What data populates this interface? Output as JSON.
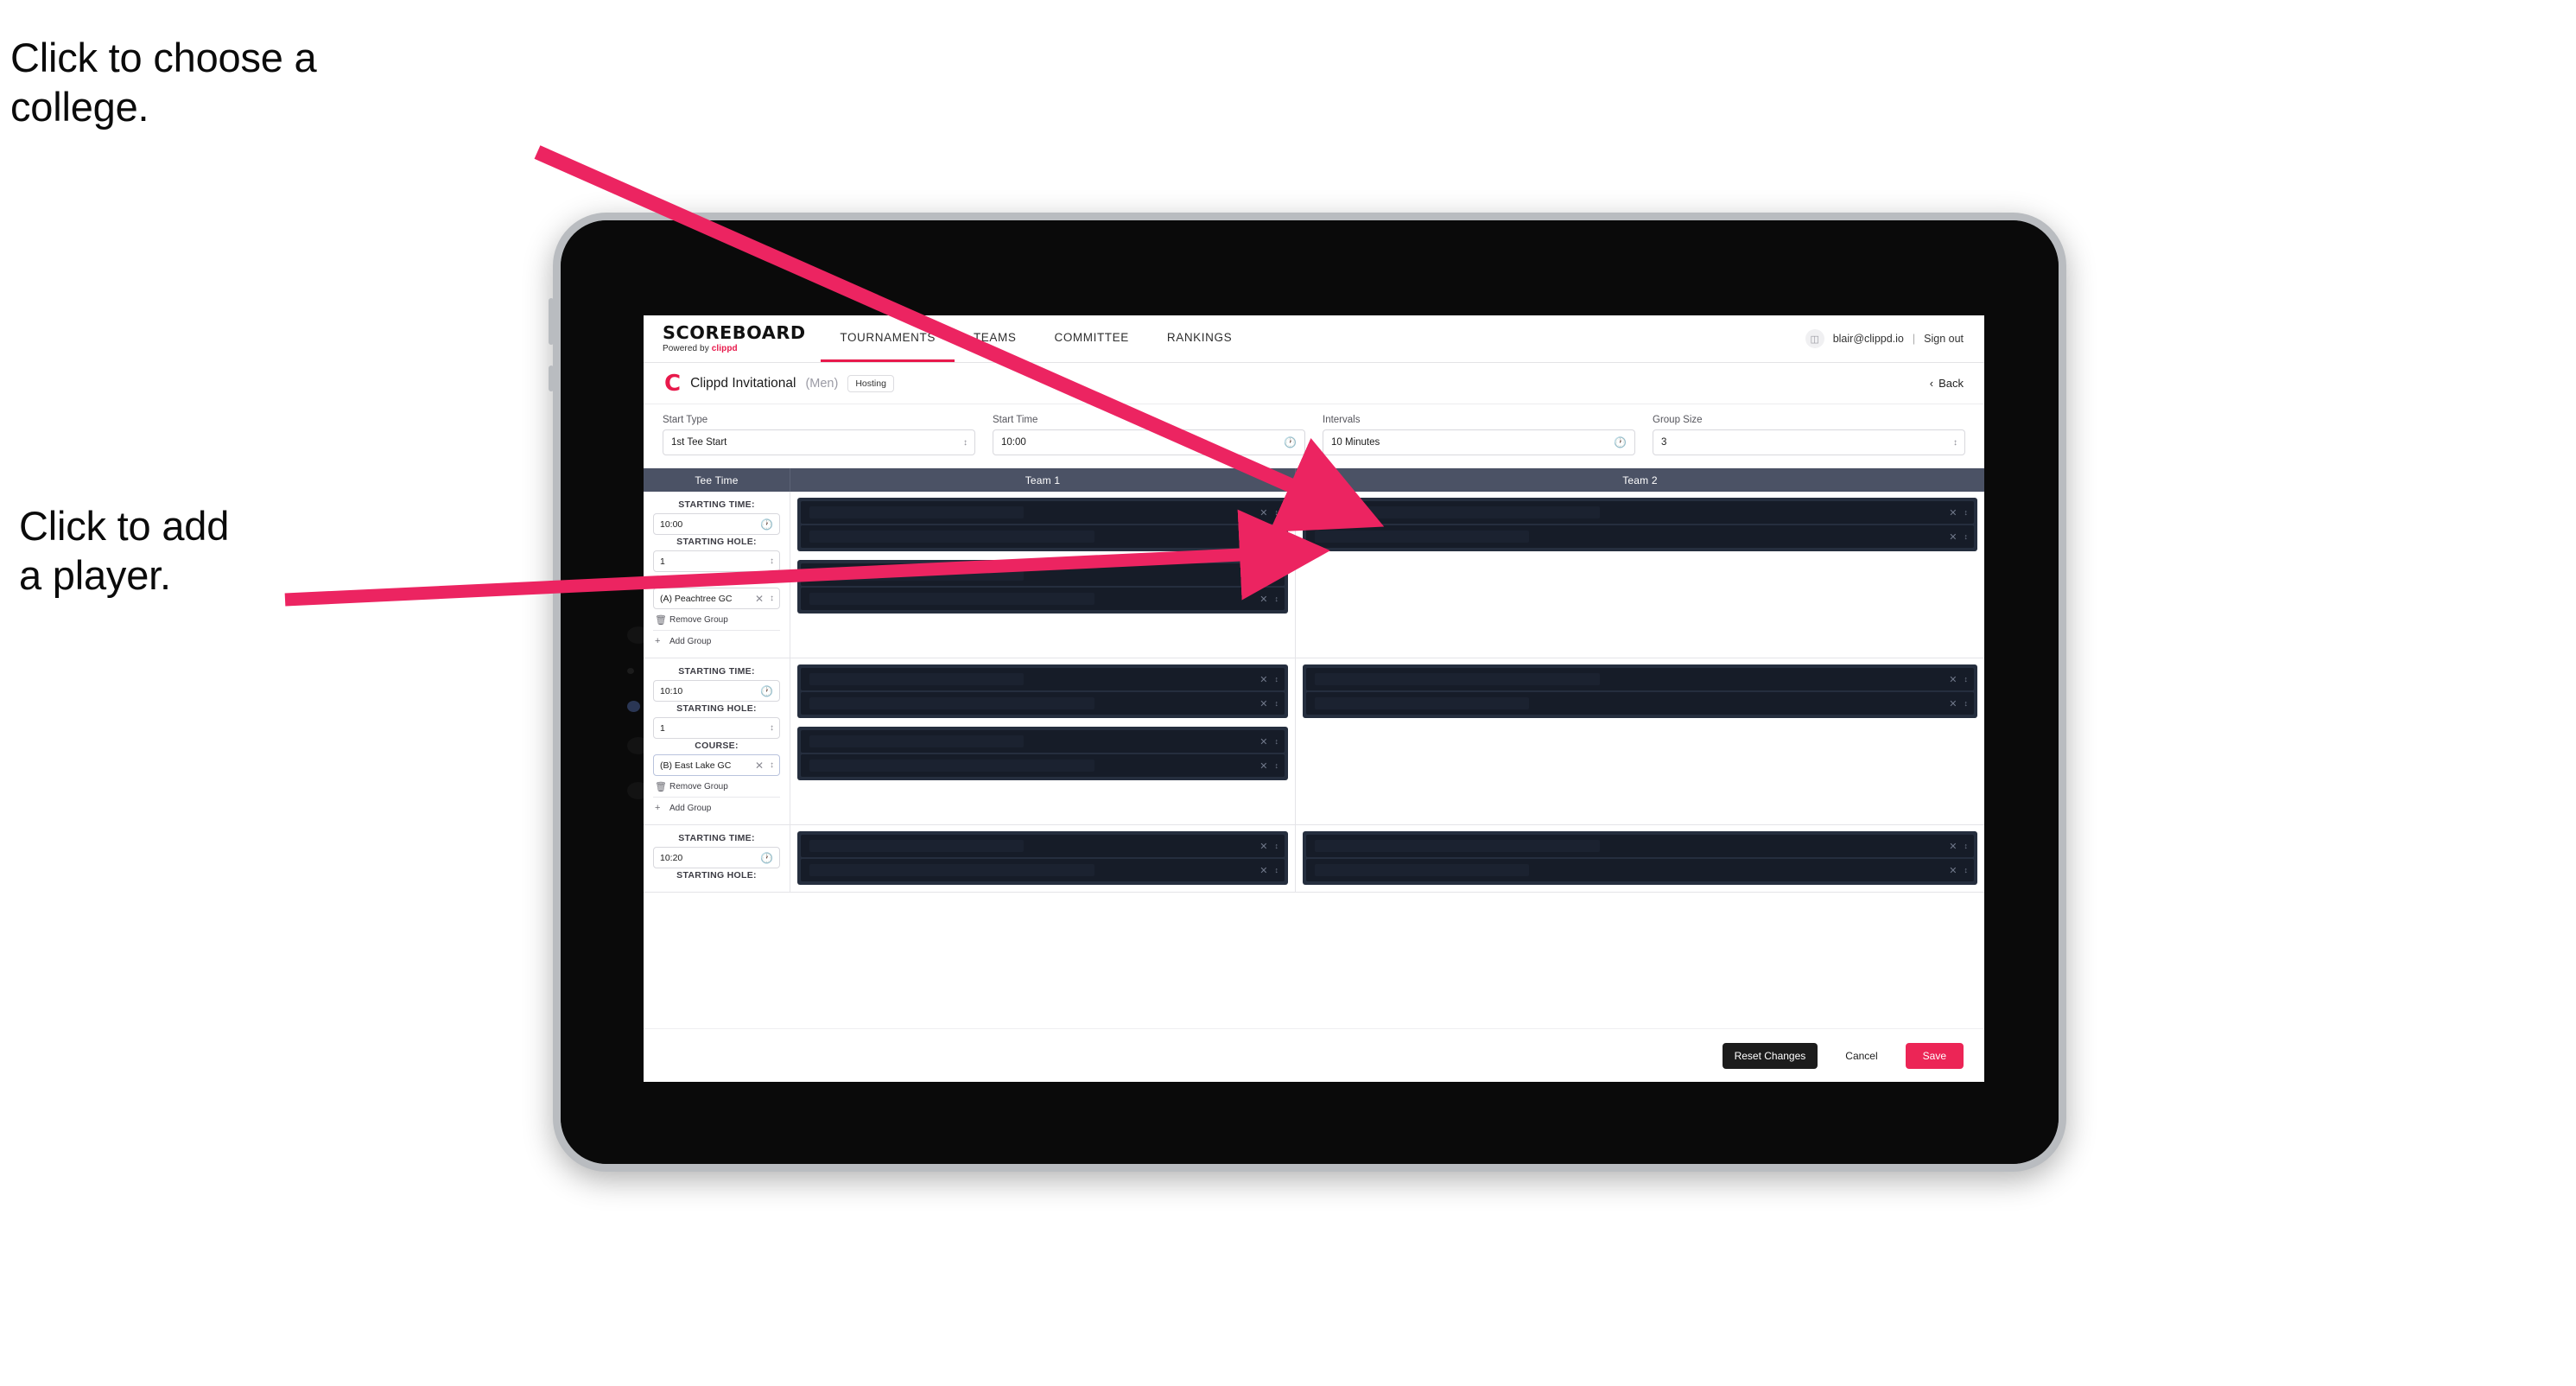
{
  "annotations": [
    {
      "id": "choose-college",
      "text": "Click to choose a\ncollege."
    },
    {
      "id": "add-player",
      "text": "Click to add\na player."
    }
  ],
  "app": {
    "nav": {
      "brand": {
        "word": "SCOREBOARD",
        "sub_prefix": "Powered by ",
        "sub_brand": "clippd"
      },
      "links": [
        {
          "label": "TOURNAMENTS",
          "active": true
        },
        {
          "label": "TEAMS",
          "active": false
        },
        {
          "label": "COMMITTEE",
          "active": false
        },
        {
          "label": "RANKINGS",
          "active": false
        }
      ],
      "account": {
        "avatar_icon": "user-icon",
        "email": "blair@clippd.io",
        "separator": "|",
        "sign_out": "Sign out"
      }
    },
    "titlebar": {
      "logo": "C",
      "title": "Clippd Invitational",
      "gender": "(Men)",
      "badge": "Hosting",
      "back_chevron": "‹",
      "back_label": "Back"
    },
    "controls": [
      {
        "label": "Start Type",
        "value": "1st Tee Start",
        "icon": "stepper-icon"
      },
      {
        "label": "Start Time",
        "value": "10:00",
        "icon": "clock-icon"
      },
      {
        "label": "Intervals",
        "value": "10 Minutes",
        "icon": "clock-icon"
      },
      {
        "label": "Group Size",
        "value": "3",
        "icon": "stepper-icon"
      }
    ],
    "table": {
      "headers": {
        "tee": "Tee Time",
        "team1": "Team 1",
        "team2": "Team 2"
      },
      "labels": {
        "starting_time": "STARTING TIME:",
        "starting_hole": "STARTING HOLE:",
        "course": "COURSE:",
        "remove_group": "Remove Group",
        "add_group": "Add Group",
        "clear_icon": "clear-icon",
        "reorder_icon": "reorder-icon"
      },
      "rows": [
        {
          "starting_time": "10:00",
          "starting_hole": "1",
          "course": "(A) Peachtree GC",
          "course_focused": false,
          "team1_groups": [
            {
              "players": [
                {
                  "redacted": true
                },
                {
                  "redacted": true
                }
              ]
            },
            {
              "players": [
                {
                  "redacted": true
                },
                {
                  "redacted": true
                }
              ]
            }
          ],
          "team2_groups": [
            {
              "players": [
                {
                  "redacted": true
                },
                {
                  "redacted": true
                }
              ]
            }
          ]
        },
        {
          "starting_time": "10:10",
          "starting_hole": "1",
          "course": "(B) East Lake GC",
          "course_focused": true,
          "team1_groups": [
            {
              "players": [
                {
                  "redacted": true
                },
                {
                  "redacted": true
                }
              ]
            },
            {
              "players": [
                {
                  "redacted": true
                },
                {
                  "redacted": true
                }
              ]
            }
          ],
          "team2_groups": [
            {
              "players": [
                {
                  "redacted": true
                },
                {
                  "redacted": true
                }
              ]
            }
          ]
        },
        {
          "starting_time": "10:20",
          "starting_hole": "",
          "course": "",
          "course_focused": false,
          "partial": true,
          "team1_groups": [
            {
              "players": [
                {
                  "redacted": true
                },
                {
                  "redacted": true
                }
              ]
            }
          ],
          "team2_groups": [
            {
              "players": [
                {
                  "redacted": true
                },
                {
                  "redacted": true
                }
              ]
            }
          ]
        }
      ]
    },
    "footer": {
      "reset": "Reset Changes",
      "cancel": "Cancel",
      "save": "Save"
    }
  },
  "colors": {
    "accent": "#ec2556",
    "header_bar": "#4b5265",
    "group_box": "#252e3e",
    "player_row": "#161c28",
    "annotation_arrow": "#ec2461"
  }
}
